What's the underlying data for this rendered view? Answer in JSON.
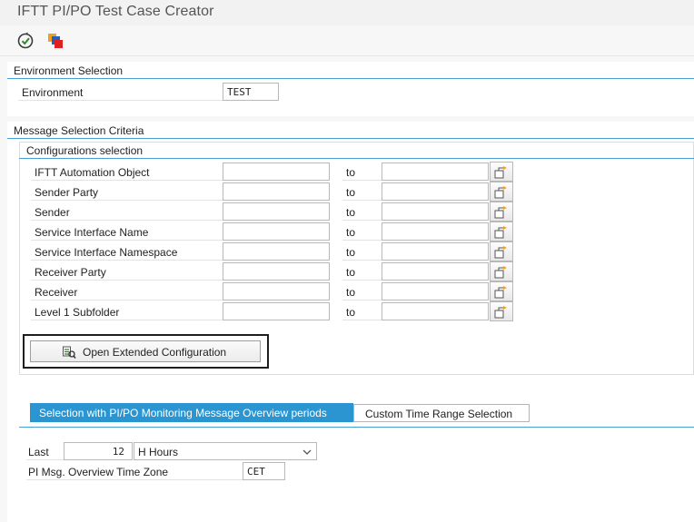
{
  "window": {
    "title": "IFTT PI/PO Test Case Creator"
  },
  "toolbar": {
    "execute_icon": "execute-check-icon",
    "variant_icon": "variant-icon"
  },
  "environment_selection": {
    "title": "Environment Selection",
    "environment_label": "Environment",
    "environment_value": "TEST"
  },
  "message_selection": {
    "title": "Message Selection Criteria",
    "configurations": {
      "title": "Configurations selection",
      "to_label": "to",
      "rows": [
        {
          "label": "IFTT Automation Object",
          "from": "",
          "to": ""
        },
        {
          "label": "Sender Party",
          "from": "",
          "to": ""
        },
        {
          "label": "Sender",
          "from": "",
          "to": ""
        },
        {
          "label": "Service Interface Name",
          "from": "",
          "to": ""
        },
        {
          "label": "Service Interface Namespace",
          "from": "",
          "to": ""
        },
        {
          "label": "Receiver Party",
          "from": "",
          "to": ""
        },
        {
          "label": "Receiver",
          "from": "",
          "to": ""
        },
        {
          "label": "Level 1 Subfolder",
          "from": "",
          "to": ""
        }
      ],
      "extended_button_label": "Open Extended Configuration"
    }
  },
  "tabs": {
    "active": "Selection with PI/PO Monitoring Message Overview periods",
    "other": "Custom Time Range Selection"
  },
  "time_selection": {
    "last_label": "Last",
    "last_value": "12",
    "unit_value": "H Hours",
    "timezone_label": "PI Msg. Overview Time Zone",
    "timezone_value": "CET"
  },
  "colors": {
    "accent": "#2a95d1",
    "group_line": "#4a9fd0"
  }
}
